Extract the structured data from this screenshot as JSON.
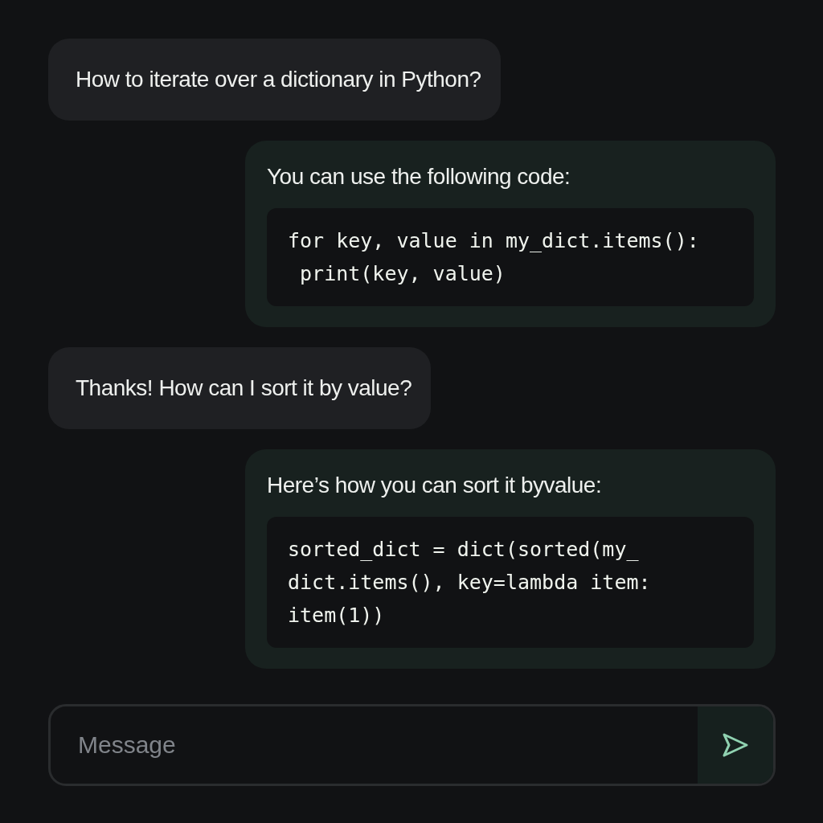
{
  "messages": [
    {
      "kind": "user",
      "text": "How to iterate over a dictionary in Python?"
    },
    {
      "kind": "assistant",
      "text": "You can use the following code:",
      "code": [
        "for key, value in my_dict.items():",
        " print(key, value)"
      ]
    },
    {
      "kind": "user",
      "text": "Thanks! How can I sort it by value?"
    },
    {
      "kind": "assistant",
      "text": "Here’s how you can sort it byvalue:",
      "code": [
        "sorted_dict = dict(sorted(my_",
        "dict.items(), key=lambda item:",
        "item(1))"
      ]
    }
  ],
  "composer": {
    "placeholder": "Message"
  }
}
